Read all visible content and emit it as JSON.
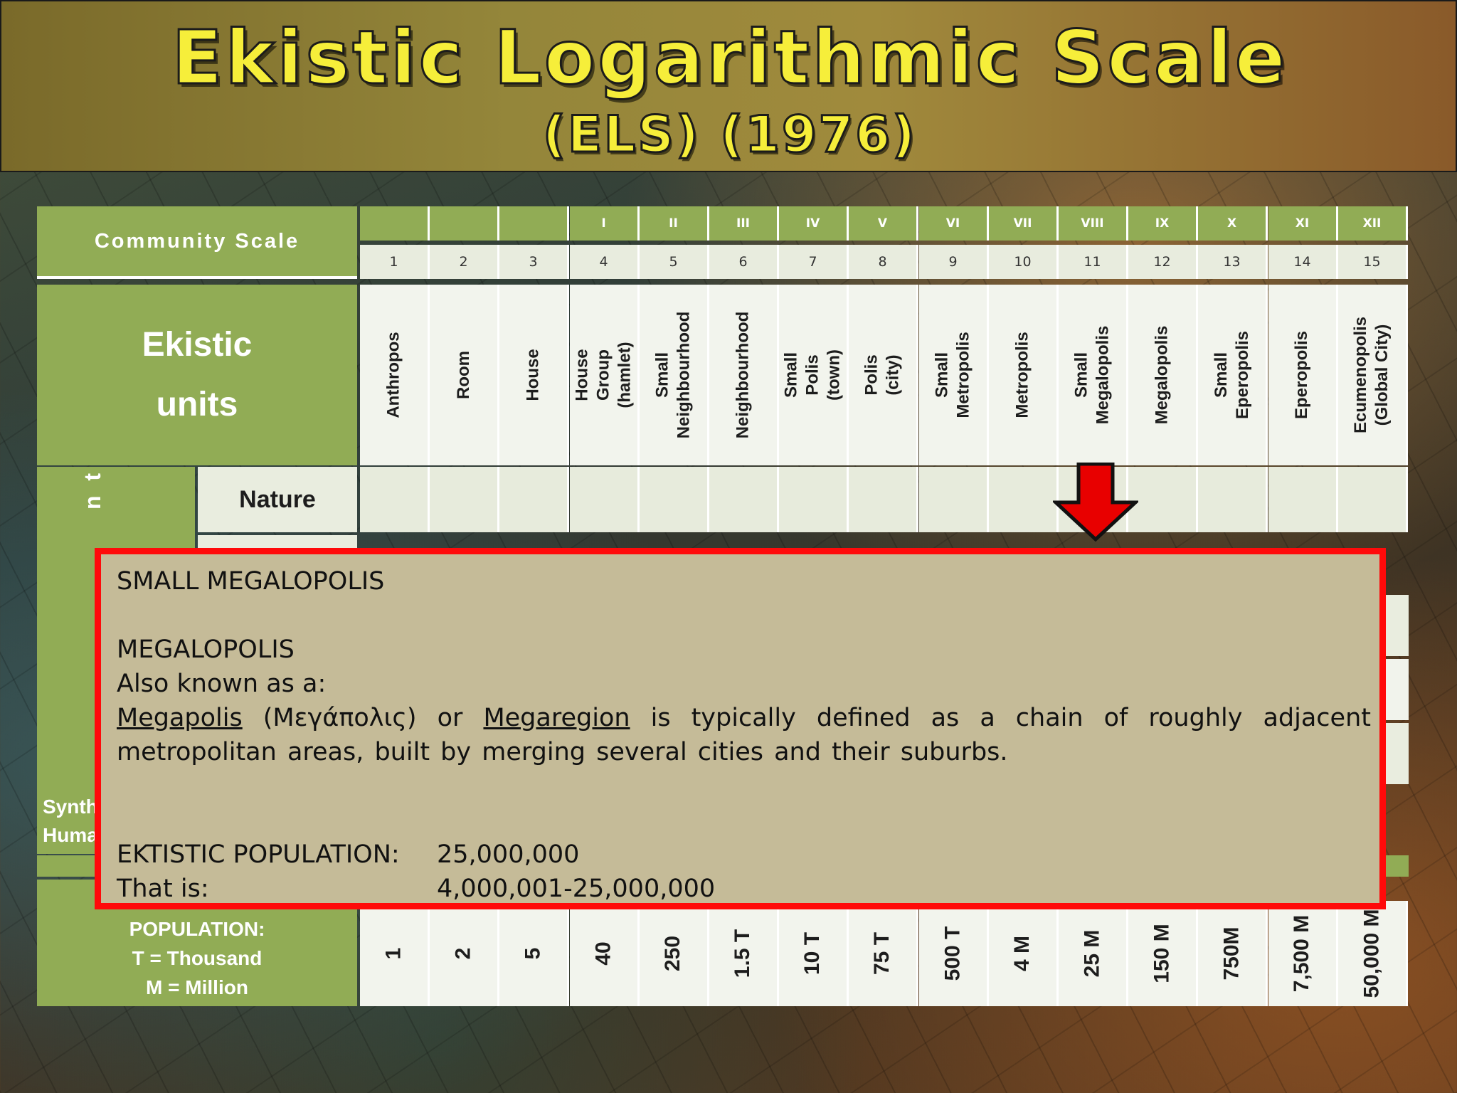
{
  "title": "Ekistic Logarithmic Scale",
  "subtitle": "(ELS) (1976)",
  "table": {
    "community_scale_label": "Community Scale",
    "ekistic_units_label": "Ekistic\nunits",
    "nature_label": "Nature",
    "elements_partial": "n t s",
    "synth_label": "Synth",
    "huma_label": "Huma",
    "population_label": "POPULATION:",
    "thousand_label": "T = Thousand",
    "million_label": "M = Million",
    "columns": [
      {
        "roman": "",
        "num": "1",
        "unit": "Anthropos",
        "pop": "1"
      },
      {
        "roman": "",
        "num": "2",
        "unit": "Room",
        "pop": "2"
      },
      {
        "roman": "",
        "num": "3",
        "unit": "House",
        "pop": "5"
      },
      {
        "roman": "I",
        "num": "4",
        "unit": "House Group\n(hamlet)",
        "pop": "40"
      },
      {
        "roman": "II",
        "num": "5",
        "unit": "Small\nNeighbourhood",
        "pop": "250"
      },
      {
        "roman": "III",
        "num": "6",
        "unit": "Neighbourhood",
        "pop": "1.5 T"
      },
      {
        "roman": "IV",
        "num": "7",
        "unit": "Small Polis\n(town)",
        "pop": "10 T"
      },
      {
        "roman": "V",
        "num": "8",
        "unit": "Polis\n(city)",
        "pop": "75 T"
      },
      {
        "roman": "VI",
        "num": "9",
        "unit": "Small Metropolis",
        "pop": "500 T"
      },
      {
        "roman": "VII",
        "num": "10",
        "unit": "Metropolis",
        "pop": "4 M"
      },
      {
        "roman": "VIII",
        "num": "11",
        "unit": "Small Megalopolis",
        "pop": "25 M"
      },
      {
        "roman": "IX",
        "num": "12",
        "unit": "Megalopolis",
        "pop": "150 M"
      },
      {
        "roman": "X",
        "num": "13",
        "unit": "Small Eperopolis",
        "pop": "750M"
      },
      {
        "roman": "XI",
        "num": "14",
        "unit": "Eperopolis",
        "pop": "7,500 M"
      },
      {
        "roman": "XII",
        "num": "15",
        "unit": "Ecumenopolis\n(Global City)",
        "pop": "50,000 M"
      }
    ]
  },
  "popup": {
    "heading": "SMALL MEGALOPOLIS",
    "subheading": "MEGALOPOLIS",
    "aka": "Also known as a:",
    "term1": "Megapolis",
    "greek": "(Μεγάπολις) or",
    "term2": "Megaregion",
    "definition": "is typically defined as a chain of roughly adjacent metropolitan areas, built by merging several cities and their suburbs.",
    "pop_key": "EKTISTIC POPULATION:",
    "pop_value": "25,000,000",
    "range_key": "That is:",
    "range_value": "4,000,001-25,000,000"
  },
  "colors": {
    "title_yellow": "#f6ee3a",
    "table_green": "#91ac55",
    "popup_bg": "#c5bb98",
    "popup_border": "#ff0a0a",
    "arrow_red": "#e80000"
  },
  "icons": [
    "down-arrow-icon"
  ]
}
